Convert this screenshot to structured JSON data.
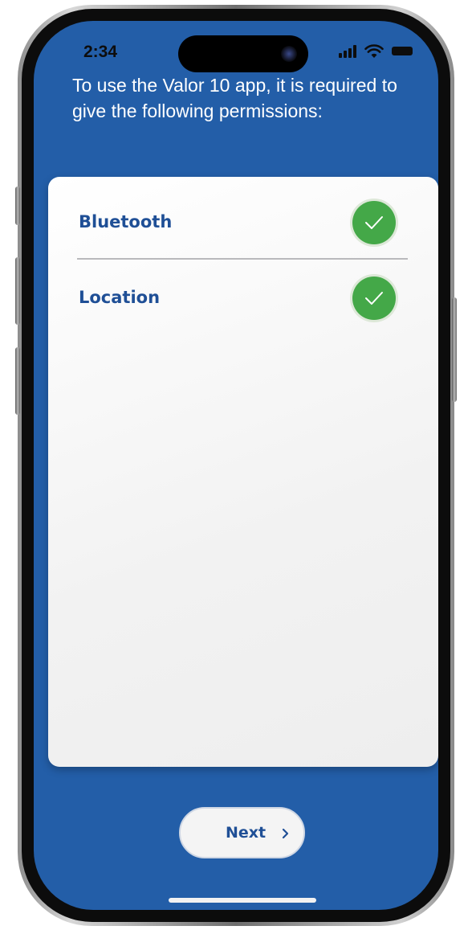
{
  "status_bar": {
    "time": "2:34",
    "icons": [
      "signal-icon",
      "wifi-icon",
      "battery-icon"
    ]
  },
  "intro": {
    "text": "To use the Valor 10 app, it is required to give the following permissions:"
  },
  "permissions": [
    {
      "label": "Bluetooth",
      "granted": true,
      "icon": "checkmark-icon"
    },
    {
      "label": "Location",
      "granted": true,
      "icon": "checkmark-icon"
    }
  ],
  "next_button": {
    "label": "Next",
    "icon": "chevron-right-icon"
  },
  "colors": {
    "background": "#235ea8",
    "card": "#f2f2f2",
    "accent_text": "#1f4f96",
    "check_green": "#44a848"
  }
}
